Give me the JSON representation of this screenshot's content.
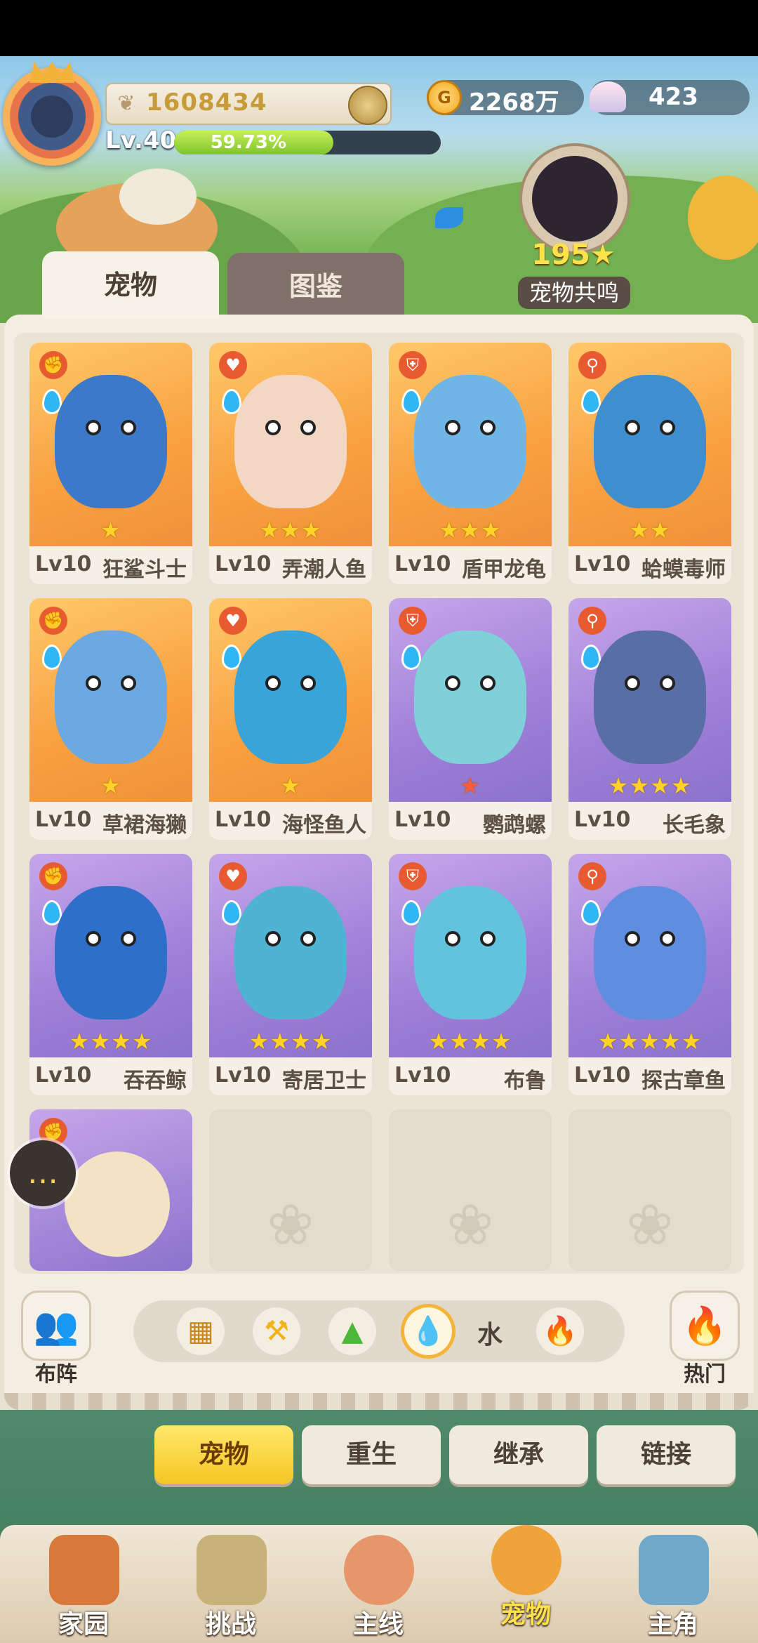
{
  "header": {
    "power": "1608434",
    "level": "Lv.40",
    "xp_percent": "59.73%",
    "xp_fraction": 0.5973,
    "gold": "2268万",
    "shells": "423",
    "resonance_count": "195",
    "resonance_label": "宠物共鸣"
  },
  "tabs": {
    "pets": "宠物",
    "codex": "图鉴"
  },
  "pets": [
    {
      "lv": "Lv10",
      "name": "狂鲨斗士",
      "stars": "★",
      "bg": "orange",
      "color": "#3d79c9"
    },
    {
      "lv": "Lv10",
      "name": "弄潮人鱼",
      "stars": "★★★",
      "bg": "orange",
      "color": "#f2d8c4"
    },
    {
      "lv": "Lv10",
      "name": "盾甲龙龟",
      "stars": "★★★",
      "bg": "orange",
      "color": "#6fb6e6"
    },
    {
      "lv": "Lv10",
      "name": "蛤蟆毒师",
      "stars": "★★",
      "bg": "orange",
      "color": "#3f8fd0"
    },
    {
      "lv": "Lv10",
      "name": "草裙海獭",
      "stars": "★",
      "bg": "orange",
      "color": "#6ca9e0"
    },
    {
      "lv": "Lv10",
      "name": "海怪鱼人",
      "stars": "★",
      "bg": "orange",
      "color": "#3aa3d8"
    },
    {
      "lv": "Lv10",
      "name": "鹦鹉螺",
      "stars": "★",
      "bg": "purple",
      "color": "#7fd0d8",
      "red": true
    },
    {
      "lv": "Lv10",
      "name": "长毛象",
      "stars": "★★★★",
      "bg": "purple",
      "color": "#5a6ea6"
    },
    {
      "lv": "Lv10",
      "name": "吞吞鲸",
      "stars": "★★★★",
      "bg": "purple",
      "color": "#2d6fc9"
    },
    {
      "lv": "Lv10",
      "name": "寄居卫士",
      "stars": "★★★★",
      "bg": "purple",
      "color": "#4fb4d4"
    },
    {
      "lv": "Lv10",
      "name": "布鲁",
      "stars": "★★★★",
      "bg": "purple",
      "color": "#63c3dc"
    },
    {
      "lv": "Lv10",
      "name": "探古章鱼",
      "stars": "★★★★★",
      "bg": "purple",
      "color": "#5f8ee0"
    }
  ],
  "filter": {
    "active_label": "水"
  },
  "side": {
    "formation": "布阵",
    "popular": "热门"
  },
  "sub_tabs": [
    "宠物",
    "重生",
    "继承",
    "链接"
  ],
  "nav": [
    "家园",
    "挑战",
    "主线",
    "宠物",
    "主角"
  ],
  "icons": {
    "chat": "chat-bubble-icon",
    "formation": "people-icon",
    "popular": "flame-icon",
    "filter": [
      "grid-icon",
      "hammer-icon",
      "mountain-icon",
      "water-drop-icon",
      "fire-icon"
    ]
  }
}
